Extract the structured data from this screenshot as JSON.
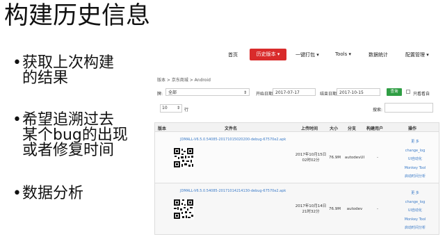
{
  "slide": {
    "title": "构建历史信息",
    "bullets": [
      {
        "lines": [
          "获取上次构建",
          "的结果"
        ]
      },
      {
        "lines": [
          "希望追溯过去",
          "某个bug的出现",
          "或者修复时间"
        ]
      },
      {
        "lines": [
          "数据分析"
        ]
      }
    ],
    "bullet_glyph": "•"
  },
  "nav": {
    "items": [
      "首页",
      "历史版本",
      "一键打包",
      "Tools",
      "数据统计",
      "配置管理"
    ],
    "active_item": "历史版本",
    "accent_color": "#d92b2b"
  },
  "breadcrumb": "版本 > 京东商城 > Android",
  "filter": {
    "platform_label": "牌:",
    "platform_value": "全部",
    "start_label": "开始日期:",
    "start_value": "2017-07-17",
    "end_label": "结束日期:",
    "end_value": "2017-10-15",
    "query_button": "查询",
    "only_mine_label": "只看看自",
    "query_color": "#2f9e44"
  },
  "pagination": {
    "page_size": "10",
    "rows_label": "行",
    "search_label": "搜索:"
  },
  "table": {
    "headers": [
      "版本",
      "文件名",
      "上传时间",
      "大小",
      "分支",
      "构建用户",
      "操作"
    ],
    "rows": [
      {
        "file": "JDMALL-V6.5.0.54085-20171015020200-debug-67570e2.apk",
        "time_line1": "2017年10月15日",
        "time_line2": "02时02分",
        "size": "76.9M",
        "branch": "autodevUI",
        "user": "-",
        "ops": [
          "更 多",
          "change_log",
          "UI自动化",
          "Monkey Tool",
          "启动时间分析"
        ]
      },
      {
        "file": "JDMALL-V6.5.0.54085-20171014214130-debug-67570e2.apk",
        "time_line1": "2017年10月14日",
        "time_line2": "21时32分",
        "size": "76.9M",
        "branch": "autodev",
        "user": "-",
        "ops": [
          "更 多",
          "change_log",
          "UI自动化",
          "Monkey Tool",
          "启动时间分析"
        ]
      }
    ]
  }
}
